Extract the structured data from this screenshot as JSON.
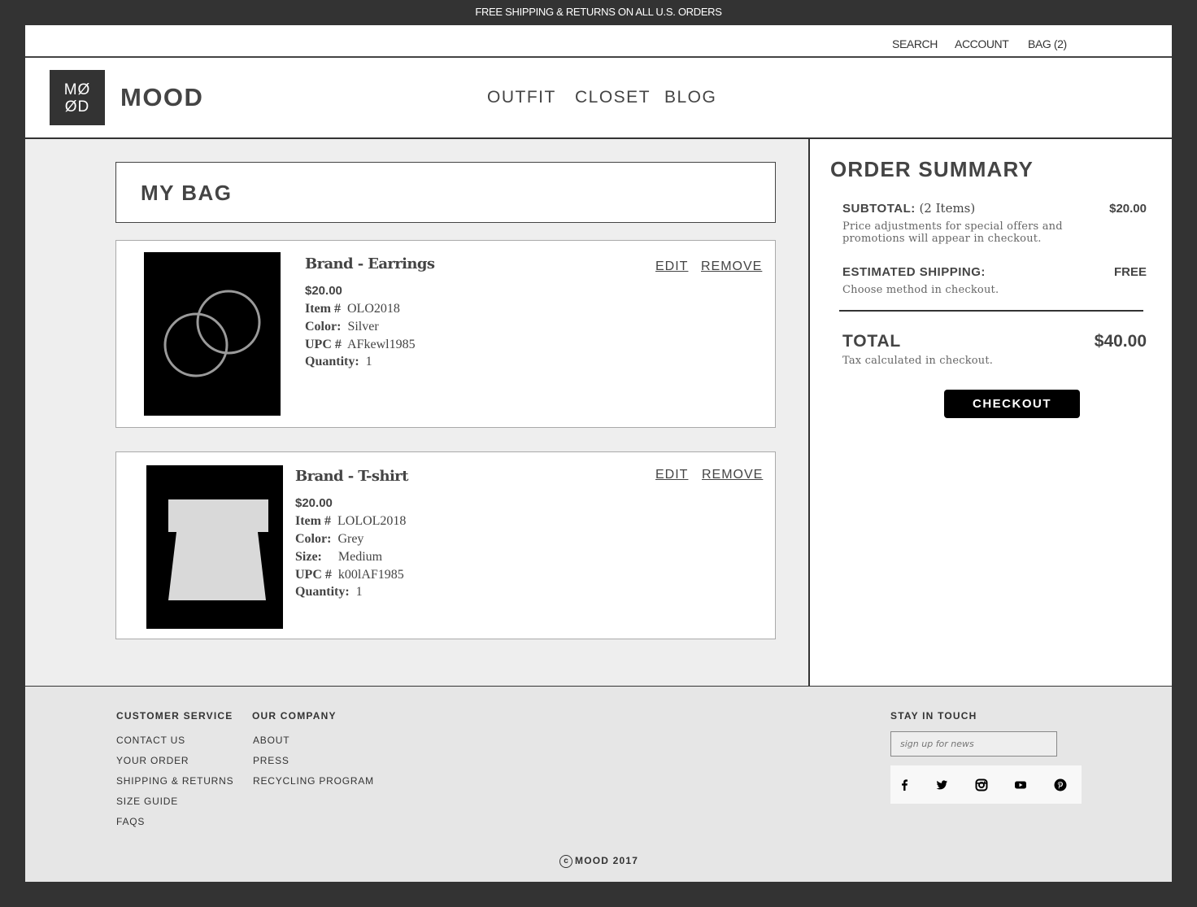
{
  "promo": {
    "text": "FREE SHIPPING & RETURNS ON ALL U.S. ORDERS"
  },
  "utility": {
    "search": "SEARCH",
    "account": "ACCOUNT",
    "bag": "BAG (2)"
  },
  "header": {
    "logo_line1": "MØ",
    "logo_line2": "ØD",
    "brand": "MOOD",
    "nav": [
      "OUTFIT",
      "CLOSET",
      "BLOG"
    ]
  },
  "bag": {
    "title": "MY BAG",
    "edit_label": "EDIT",
    "remove_label": "REMOVE",
    "items": [
      {
        "name": "Brand  - Earrings",
        "price": "$20.00",
        "item_label": "Item #",
        "item_no": "OLO2018",
        "color_label": "Color:",
        "color": "Silver",
        "upc_label": "UPC #",
        "upc": "AFkewl1985",
        "qty_label": "Quantity:",
        "qty": "1",
        "image": "earrings-image"
      },
      {
        "name": "Brand - T-shirt",
        "price": "$20.00",
        "item_label": "Item #",
        "item_no": "LOLOL2018",
        "color_label": "Color:",
        "color": "Grey",
        "size_label": "Size:",
        "size": "Medium",
        "upc_label": "UPC #",
        "upc": "k00lAF1985",
        "qty_label": "Quantity:",
        "qty": "1",
        "image": "tshirt-image"
      }
    ]
  },
  "summary": {
    "title": "ORDER SUMMARY",
    "subtotal_label": "SUBTOTAL:",
    "subtotal_count": "(2 Items)",
    "subtotal_value": "$20.00",
    "subtotal_note_1": "Price adjustments for special offers and",
    "subtotal_note_2": "promotions will appear in checkout.",
    "shipping_label": "ESTIMATED SHIPPING:",
    "shipping_value": "FREE",
    "shipping_note": "Choose method in checkout.",
    "total_label": "TOTAL",
    "total_value": "$40.00",
    "total_note": "Tax calculated in checkout.",
    "checkout_label": "CHECKOUT"
  },
  "footer": {
    "customer_service": {
      "heading": "CUSTOMER SERVICE",
      "links": [
        "CONTACT US",
        "YOUR ORDER",
        "SHIPPING & RETURNS",
        "SIZE GUIDE",
        "FAQS"
      ]
    },
    "our_company": {
      "heading": "OUR COMPANY",
      "links": [
        "ABOUT",
        "PRESS",
        "RECYCLING PROGRAM"
      ]
    },
    "stay_in_touch": {
      "heading": "STAY IN TOUCH",
      "placeholder": "sign up for news",
      "social_icons": [
        "facebook-icon",
        "twitter-icon",
        "instagram-icon",
        "youtube-icon",
        "pinterest-icon"
      ]
    },
    "copyright_symbol": "c",
    "copyright": "MOOD 2017"
  },
  "colors": {
    "frame": "#333333",
    "panel": "#eeeeee",
    "footer": "#e6e6e6",
    "button": "#000000",
    "thumb_bg": "#000000",
    "product_grey": "#d9d9d9"
  }
}
